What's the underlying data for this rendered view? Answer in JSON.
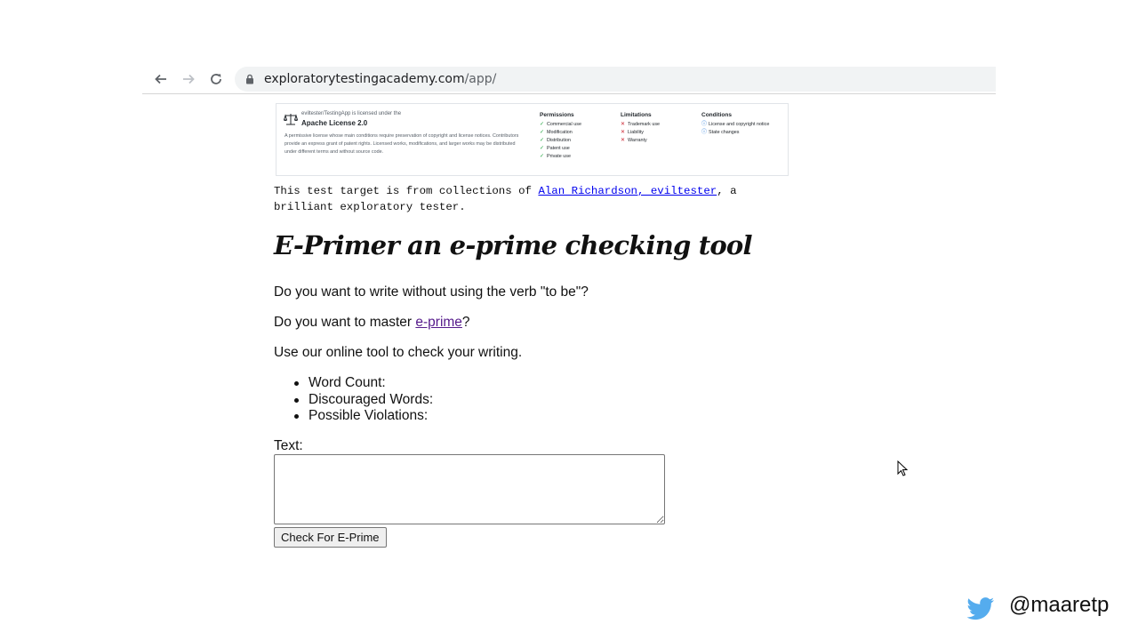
{
  "browser": {
    "url_domain": "exploratorytestingacademy.com",
    "url_path": "/app/"
  },
  "license_card": {
    "subtitle": "eviltester/TestingApp is licensed under the",
    "name": "Apache License 2.0",
    "description": "A permissive license whose main conditions require preservation of copyright and license notices. Contributors provide an express grant of patent rights. Licensed works, modifications, and larger works may be distributed under different terms and without source code.",
    "permissions": {
      "heading": "Permissions",
      "items": [
        "Commercial use",
        "Modification",
        "Distribution",
        "Patent use",
        "Private use"
      ]
    },
    "limitations": {
      "heading": "Limitations",
      "items": [
        "Trademark use",
        "Liability",
        "Warranty"
      ]
    },
    "conditions": {
      "heading": "Conditions",
      "items": [
        "License and copyright notice",
        "State changes"
      ]
    }
  },
  "source": {
    "prefix": "This test target is from collections of ",
    "link_text": "Alan Richardson, eviltester",
    "suffix": ", a brilliant exploratory tester."
  },
  "page": {
    "title": "E-Primer an e-prime checking tool",
    "para1": "Do you want to write without using the verb \"to be\"?",
    "para2_prefix": "Do you want to master ",
    "para2_link": "e-prime",
    "para2_suffix": "?",
    "para3": "Use our online tool to check your writing."
  },
  "stats": {
    "word_count_label": "Word Count:",
    "discouraged_label": "Discouraged Words:",
    "violations_label": "Possible Violations:"
  },
  "form": {
    "text_label": "Text:",
    "text_value": "",
    "submit_label": "Check For E-Prime"
  },
  "footer": {
    "handle": "@maaretp",
    "twitter_color": "#55acee"
  }
}
